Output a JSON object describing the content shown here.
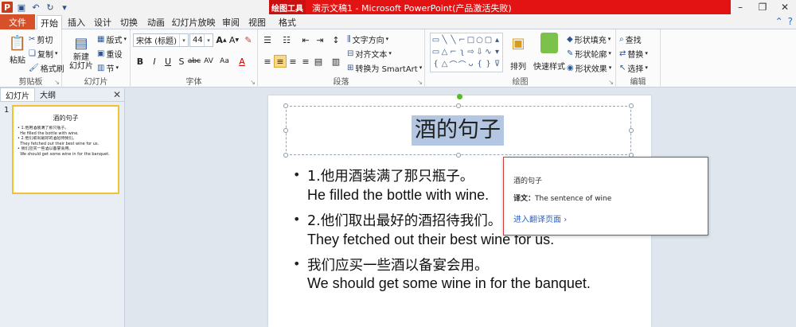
{
  "titlebar": {
    "context_tab_label": "绘图工具",
    "window_title": "演示文稿1 - Microsoft PowerPoint(产品激活失败)",
    "qat_icons": [
      "powerpoint-logo-icon",
      "save-icon",
      "undo-icon",
      "redo-icon",
      "customize-icon"
    ]
  },
  "tabs": {
    "file": "文件",
    "home": "开始",
    "insert": "插入",
    "design": "设计",
    "transitions": "切换",
    "animations": "动画",
    "slideshow": "幻灯片放映",
    "review": "审阅",
    "view": "视图",
    "format": "格式"
  },
  "ribbon": {
    "clipboard": {
      "label": "剪贴板",
      "paste": "粘贴",
      "cut": "剪切",
      "copy": "复制",
      "format_painter": "格式刷"
    },
    "slides": {
      "label": "幻灯片",
      "new_slide": "新建\n幻灯片",
      "layout": "版式",
      "reset": "重设",
      "section": "节"
    },
    "font": {
      "label": "字体",
      "font_name": "宋体 (标题)",
      "font_size": "44"
    },
    "paragraph": {
      "label": "段落",
      "text_direction": "文字方向",
      "align_text": "对齐文本",
      "smartart": "转换为 SmartArt"
    },
    "drawing": {
      "label": "绘图",
      "arrange": "排列",
      "quick_styles": "快速样式",
      "shape_fill": "形状填充",
      "shape_outline": "形状轮廓",
      "shape_effects": "形状效果"
    },
    "editing": {
      "label": "编辑",
      "find": "查找",
      "replace": "替换",
      "select": "选择"
    }
  },
  "left_panel": {
    "tab_slides": "幻灯片",
    "tab_outline": "大纲",
    "slide_number": "1",
    "thumb_title": "酒的句子"
  },
  "slide": {
    "title": "酒的句子",
    "items": [
      {
        "zh": "1.他用酒装满了那只瓶子。",
        "en": "He filled the bottle with wine."
      },
      {
        "zh": "2.他们取出最好的酒招待我们。",
        "en": "They fetched out their best wine for us."
      },
      {
        "zh": "我们应买一些酒以备宴会用。",
        "en": "We should get some wine in for the banquet."
      }
    ]
  },
  "translation_popup": {
    "source": "酒的句子",
    "label": "译文：",
    "translation": "The sentence of wine",
    "link": "进入翻译页面"
  }
}
